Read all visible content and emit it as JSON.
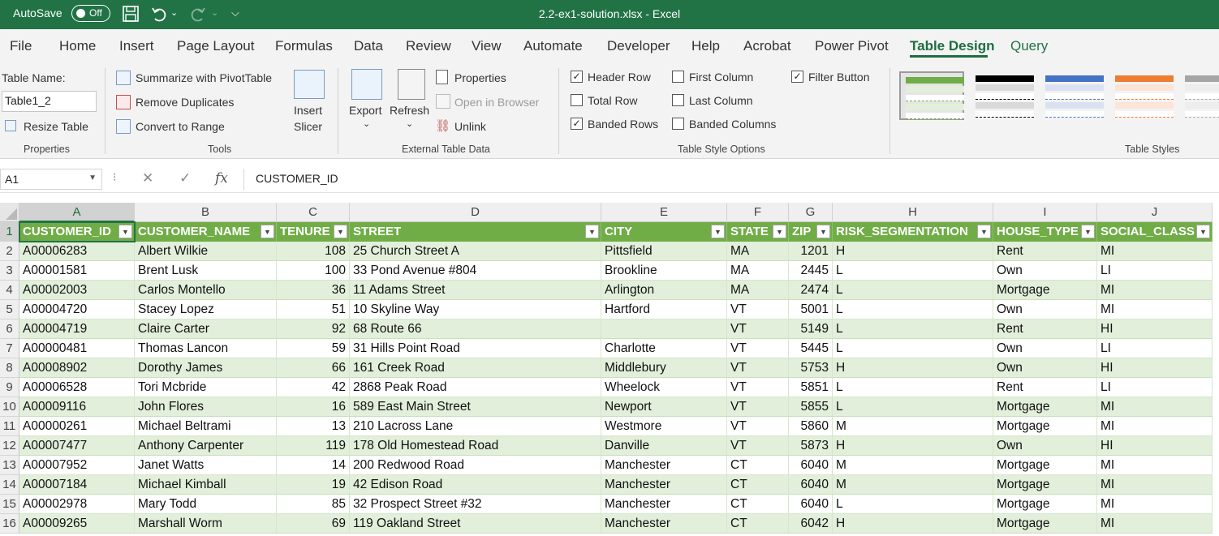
{
  "titlebar": {
    "autosave_label": "AutoSave",
    "autosave_state": "Off",
    "doc_title": "2.2-ex1-solution.xlsx  -  Excel",
    "quick_access": [
      "save-icon",
      "undo-icon",
      "redo-icon",
      "customize-icon"
    ]
  },
  "menu": {
    "tabs": [
      "File",
      "Home",
      "Insert",
      "Page Layout",
      "Formulas",
      "Data",
      "Review",
      "View",
      "Automate",
      "Developer",
      "Help",
      "Acrobat",
      "Power Pivot",
      "Table Design",
      "Query"
    ],
    "active": "Table Design"
  },
  "ribbon": {
    "properties": {
      "table_name_label": "Table Name:",
      "table_name_value": "Table1_2",
      "resize": "Resize Table",
      "group": "Properties"
    },
    "tools": {
      "summarize": "Summarize with PivotTable",
      "remove_dup": "Remove Duplicates",
      "convert": "Convert to Range",
      "slicer_line1": "Insert",
      "slicer_line2": "Slicer",
      "group": "Tools"
    },
    "external": {
      "export": "Export",
      "refresh": "Refresh",
      "properties": "Properties",
      "open_browser": "Open in Browser",
      "unlink": "Unlink",
      "group": "External Table Data"
    },
    "style_options": {
      "header_row": "Header Row",
      "total_row": "Total Row",
      "banded_rows": "Banded Rows",
      "first_column": "First Column",
      "last_column": "Last Column",
      "banded_columns": "Banded Columns",
      "filter_button": "Filter Button",
      "header_row_checked": true,
      "total_row_checked": false,
      "banded_rows_checked": true,
      "first_column_checked": false,
      "last_column_checked": false,
      "banded_columns_checked": false,
      "filter_button_checked": true,
      "group": "Table Style Options"
    },
    "table_styles": {
      "group": "Table Styles",
      "thumb_colors": [
        "#70ad47",
        "#000000",
        "#4472c4",
        "#ed7d31",
        "#a5a5a5"
      ]
    }
  },
  "formula_bar": {
    "name_box": "A1",
    "cancel_symbol": "✕",
    "enter_symbol": "✓",
    "fx_symbol": "fx",
    "value": "CUSTOMER_ID"
  },
  "sheet": {
    "column_letters": [
      "A",
      "B",
      "C",
      "D",
      "E",
      "F",
      "G",
      "H",
      "I",
      "J"
    ],
    "header_row_number": "1",
    "headers": [
      "CUSTOMER_ID",
      "CUSTOMER_NAME",
      "TENURE",
      "STREET",
      "CITY",
      "STATE",
      "ZIP",
      "RISK_SEGMENTATION",
      "HOUSE_TYPE",
      "SOCIAL_CLASS"
    ],
    "rows": [
      {
        "n": "2",
        "cells": [
          "A00006283",
          "Albert Wilkie",
          "108",
          "25 Church Street A",
          "Pittsfield",
          "MA",
          "1201",
          "H",
          "Rent",
          "MI"
        ]
      },
      {
        "n": "3",
        "cells": [
          "A00001581",
          "Brent Lusk",
          "100",
          "33 Pond Avenue #804",
          "Brookline",
          "MA",
          "2445",
          "L",
          "Own",
          "LI"
        ]
      },
      {
        "n": "4",
        "cells": [
          "A00002003",
          "Carlos Montello",
          "36",
          "11 Adams Street",
          "Arlington",
          "MA",
          "2474",
          "L",
          "Mortgage",
          "MI"
        ]
      },
      {
        "n": "5",
        "cells": [
          "A00004720",
          "Stacey Lopez",
          "51",
          "10 Skyline Way",
          "Hartford",
          "VT",
          "5001",
          "L",
          "Own",
          "MI"
        ]
      },
      {
        "n": "6",
        "cells": [
          "A00004719",
          "Claire Carter",
          "92",
          "68 Route 66",
          "",
          "VT",
          "5149",
          "L",
          "Rent",
          "HI"
        ]
      },
      {
        "n": "7",
        "cells": [
          "A00000481",
          "Thomas Lancon",
          "59",
          "31 Hills Point Road",
          "Charlotte",
          "VT",
          "5445",
          "L",
          "Own",
          "LI"
        ]
      },
      {
        "n": "8",
        "cells": [
          "A00008902",
          "Dorothy James",
          "66",
          "161 Creek Road",
          "Middlebury",
          "VT",
          "5753",
          "H",
          "Own",
          "HI"
        ]
      },
      {
        "n": "9",
        "cells": [
          "A00006528",
          "Tori Mcbride",
          "42",
          "2868 Peak Road",
          "Wheelock",
          "VT",
          "5851",
          "L",
          "Rent",
          "LI"
        ]
      },
      {
        "n": "10",
        "cells": [
          "A00009116",
          "John Flores",
          "16",
          "589 East Main Street",
          "Newport",
          "VT",
          "5855",
          "L",
          "Mortgage",
          "MI"
        ]
      },
      {
        "n": "11",
        "cells": [
          "A00000261",
          "Michael Beltrami",
          "13",
          "210 Lacross Lane",
          "Westmore",
          "VT",
          "5860",
          "M",
          "Mortgage",
          "MI"
        ]
      },
      {
        "n": "12",
        "cells": [
          "A00007477",
          "Anthony Carpenter",
          "119",
          "178 Old Homestead Road",
          "Danville",
          "VT",
          "5873",
          "H",
          "Own",
          "HI"
        ]
      },
      {
        "n": "13",
        "cells": [
          "A00007952",
          "Janet Watts",
          "14",
          "200 Redwood Road",
          "Manchester",
          "CT",
          "6040",
          "M",
          "Mortgage",
          "MI"
        ]
      },
      {
        "n": "14",
        "cells": [
          "A00007184",
          "Michael Kimball",
          "19",
          "42 Edison Road",
          "Manchester",
          "CT",
          "6040",
          "M",
          "Mortgage",
          "MI"
        ]
      },
      {
        "n": "15",
        "cells": [
          "A00002978",
          "Mary Todd",
          "85",
          "32 Prospect Street #32",
          "Manchester",
          "CT",
          "6040",
          "L",
          "Mortgage",
          "MI"
        ]
      },
      {
        "n": "16",
        "cells": [
          "A00009265",
          "Marshall Worm",
          "69",
          "119 Oakland Street",
          "Manchester",
          "CT",
          "6042",
          "H",
          "Mortgage",
          "MI"
        ]
      }
    ],
    "colors": {
      "header_bg": "#70ad47",
      "band_bg": "#e2efda",
      "accent": "#217346"
    }
  }
}
